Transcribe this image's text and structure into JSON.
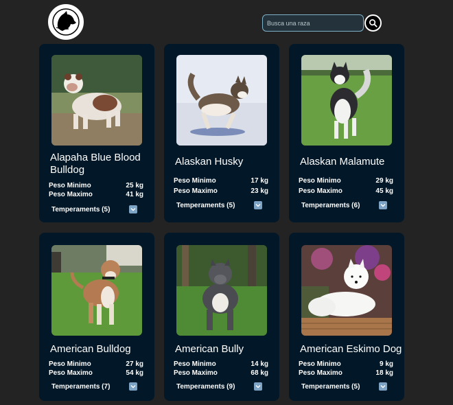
{
  "header": {
    "logo_icon": "dog-head-logo",
    "search": {
      "placeholder": "Busca una raza",
      "value": ""
    },
    "search_icon": "magnifier-icon"
  },
  "labels": {
    "min_weight": "Peso Minimo",
    "max_weight": "Peso Maximo"
  },
  "breeds": [
    {
      "name": "Alapaha Blue Blood Bulldog",
      "min": "25 kg",
      "max": "41 kg",
      "temperaments": "Temperaments (5)",
      "photo": "brown-white-bulldog-on-dirt"
    },
    {
      "name": "Alaskan Husky",
      "min": "17 kg",
      "max": "23 kg",
      "temperaments": "Temperaments (5)",
      "photo": "husky-running-in-snow"
    },
    {
      "name": "Alaskan Malamute",
      "min": "29 kg",
      "max": "45 kg",
      "temperaments": "Temperaments (6)",
      "photo": "malamute-on-grass"
    },
    {
      "name": "American Bulldog",
      "min": "27 kg",
      "max": "54 kg",
      "temperaments": "Temperaments (7)",
      "photo": "bulldog-on-grass"
    },
    {
      "name": "American Bully",
      "min": "14 kg",
      "max": "68 kg",
      "temperaments": "Temperaments (9)",
      "photo": "gray-bully-on-grass"
    },
    {
      "name": "American Eskimo Dog",
      "min": "9 kg",
      "max": "18 kg",
      "temperaments": "Temperaments (5)",
      "photo": "white-eskimo-dog-on-deck"
    }
  ],
  "colors": {
    "background": "#232323",
    "card": "#021727",
    "chevron": "#7da4c4",
    "search_border": "#7fb2c8"
  }
}
